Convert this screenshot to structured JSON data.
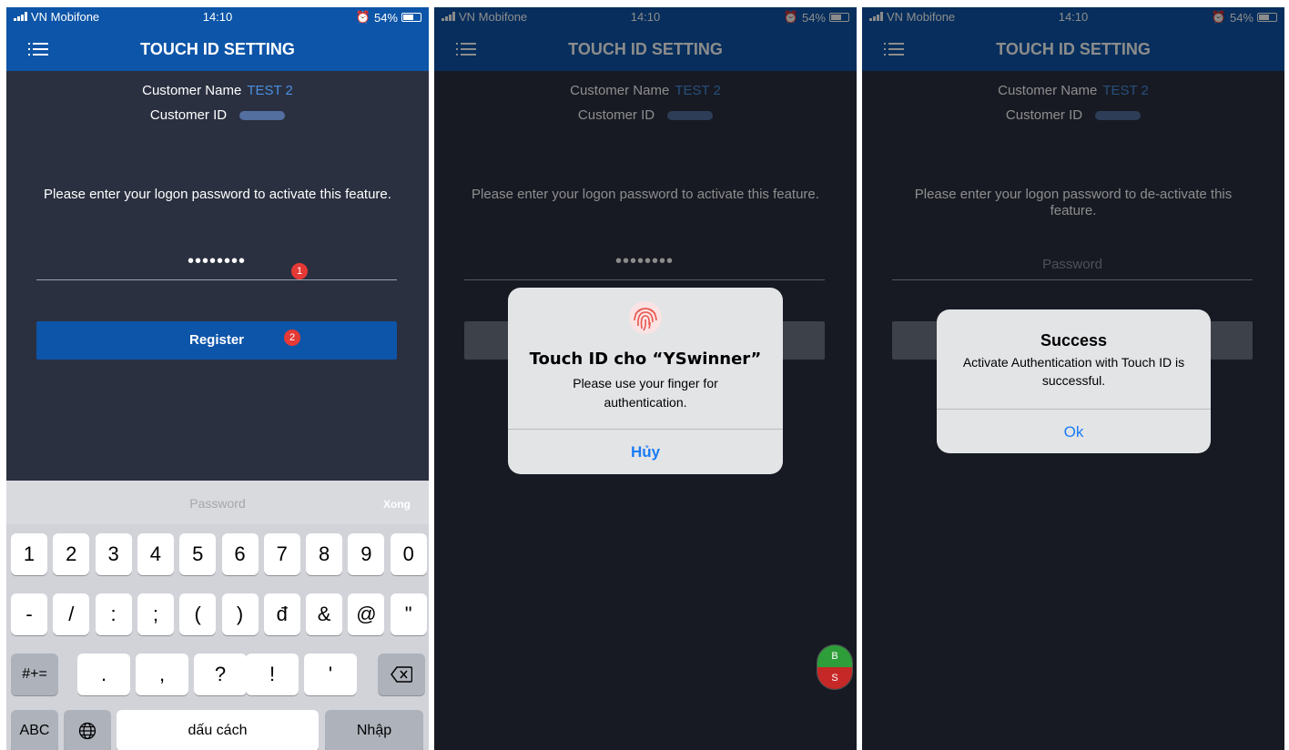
{
  "status": {
    "carrier": "VN Mobifone",
    "time": "14:10",
    "battery": "54%"
  },
  "header": {
    "title": "TOUCH ID SETTING"
  },
  "customer": {
    "name_label": "Customer Name",
    "name_value": "TEST 2",
    "id_label": "Customer ID"
  },
  "screen1": {
    "instruction": "Please enter your logon password to activate this feature.",
    "password_mask": "••••••••",
    "register_label": "Register",
    "badge_1": "1",
    "badge_2": "2",
    "keyboard": {
      "placeholder": "Password",
      "done": "Xong",
      "row1": [
        "1",
        "2",
        "3",
        "4",
        "5",
        "6",
        "7",
        "8",
        "9",
        "0"
      ],
      "row2": [
        "-",
        "/",
        ":",
        ";",
        "(",
        ")",
        "đ",
        "&",
        "@",
        "\""
      ],
      "row3_shift": "#+=",
      "row3": [
        ".",
        ",",
        "?",
        "!",
        "'"
      ],
      "abc": "ABC",
      "space": "dấu cách",
      "enter": "Nhập"
    }
  },
  "screen2": {
    "instruction": "Please enter your logon password to activate this feature.",
    "password_mask": "••••••••",
    "dialog_title": "Touch ID cho “YSwinner”",
    "dialog_message": "Please use your finger for authentication.",
    "cancel": "Hủy",
    "fab_top": "B",
    "fab_bottom": "S"
  },
  "screen3": {
    "instruction": "Please enter your logon password to de-activate this feature.",
    "password_placeholder": "Password",
    "dialog_title": "Success",
    "dialog_message": "Activate Authentication with Touch ID is successful.",
    "ok": "Ok"
  },
  "colors": {
    "header": "#0d55a8",
    "background": "#2a3040",
    "accent": "#1a7cf5",
    "badge": "#e53935"
  }
}
